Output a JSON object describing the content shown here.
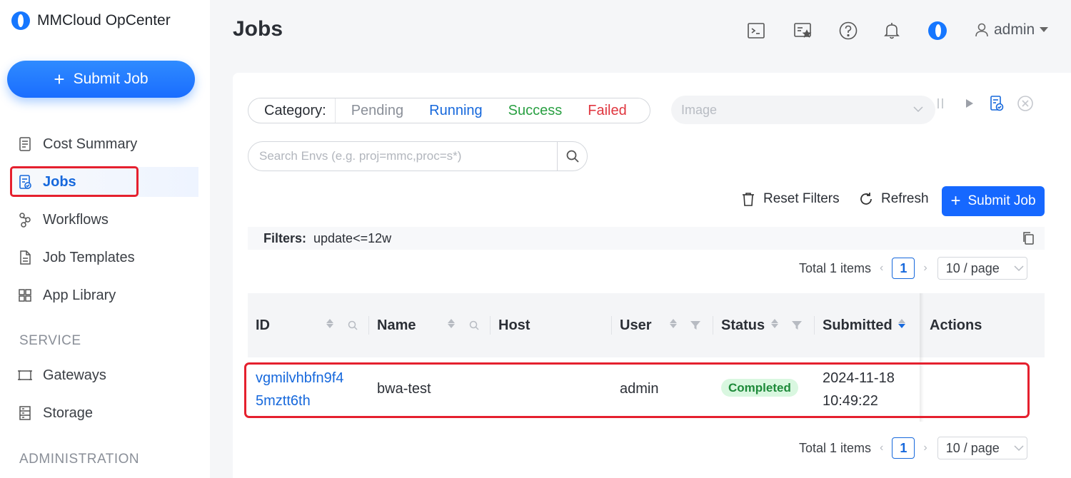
{
  "app": {
    "name": "MMCloud OpCenter"
  },
  "sidebar": {
    "submit_label": "Submit Job",
    "items": [
      {
        "label": "Cost Summary",
        "icon": "receipt-icon"
      },
      {
        "label": "Jobs",
        "icon": "job-doc-icon",
        "active": true
      },
      {
        "label": "Workflows",
        "icon": "workflow-icon"
      },
      {
        "label": "Job Templates",
        "icon": "template-icon"
      },
      {
        "label": "App Library",
        "icon": "grid-icon"
      }
    ],
    "service_section": "SERVICE",
    "service_items": [
      {
        "label": "Gateways",
        "icon": "gateway-icon"
      },
      {
        "label": "Storage",
        "icon": "storage-icon"
      }
    ],
    "admin_section": "ADMINISTRATION"
  },
  "header": {
    "title": "Jobs",
    "icons": [
      "terminal-icon",
      "favorites-icon",
      "help-icon",
      "bell-icon",
      "brand-icon"
    ],
    "user": "admin"
  },
  "filters": {
    "category_label": "Category:",
    "categories": [
      "Pending",
      "Running",
      "Success",
      "Failed"
    ],
    "image_placeholder": "Image",
    "search_placeholder": "Search Envs (e.g. proj=mmc,proc=s*)",
    "reset_label": "Reset Filters",
    "refresh_label": "Refresh",
    "submit_label": "Submit Job",
    "active_label": "Filters:",
    "active_value": "update<=12w"
  },
  "pagination": {
    "total": "Total 1 items",
    "current_page": "1",
    "page_size": "10 / page"
  },
  "table": {
    "columns": [
      "ID",
      "Name",
      "Host",
      "User",
      "Status",
      "Submitted",
      "Actions"
    ],
    "rows": [
      {
        "id_line1": "vgmilvhbfn9f4",
        "id_line2": "5mztt6th",
        "name": "bwa-test",
        "host": "",
        "user": "admin",
        "status": "Completed",
        "submitted_date": "2024-11-18",
        "submitted_time": "10:49:22"
      }
    ]
  },
  "colors": {
    "accent": "#1668dc",
    "success": "#2aa043",
    "failed": "#e0363f",
    "highlight": "#e5202e"
  }
}
